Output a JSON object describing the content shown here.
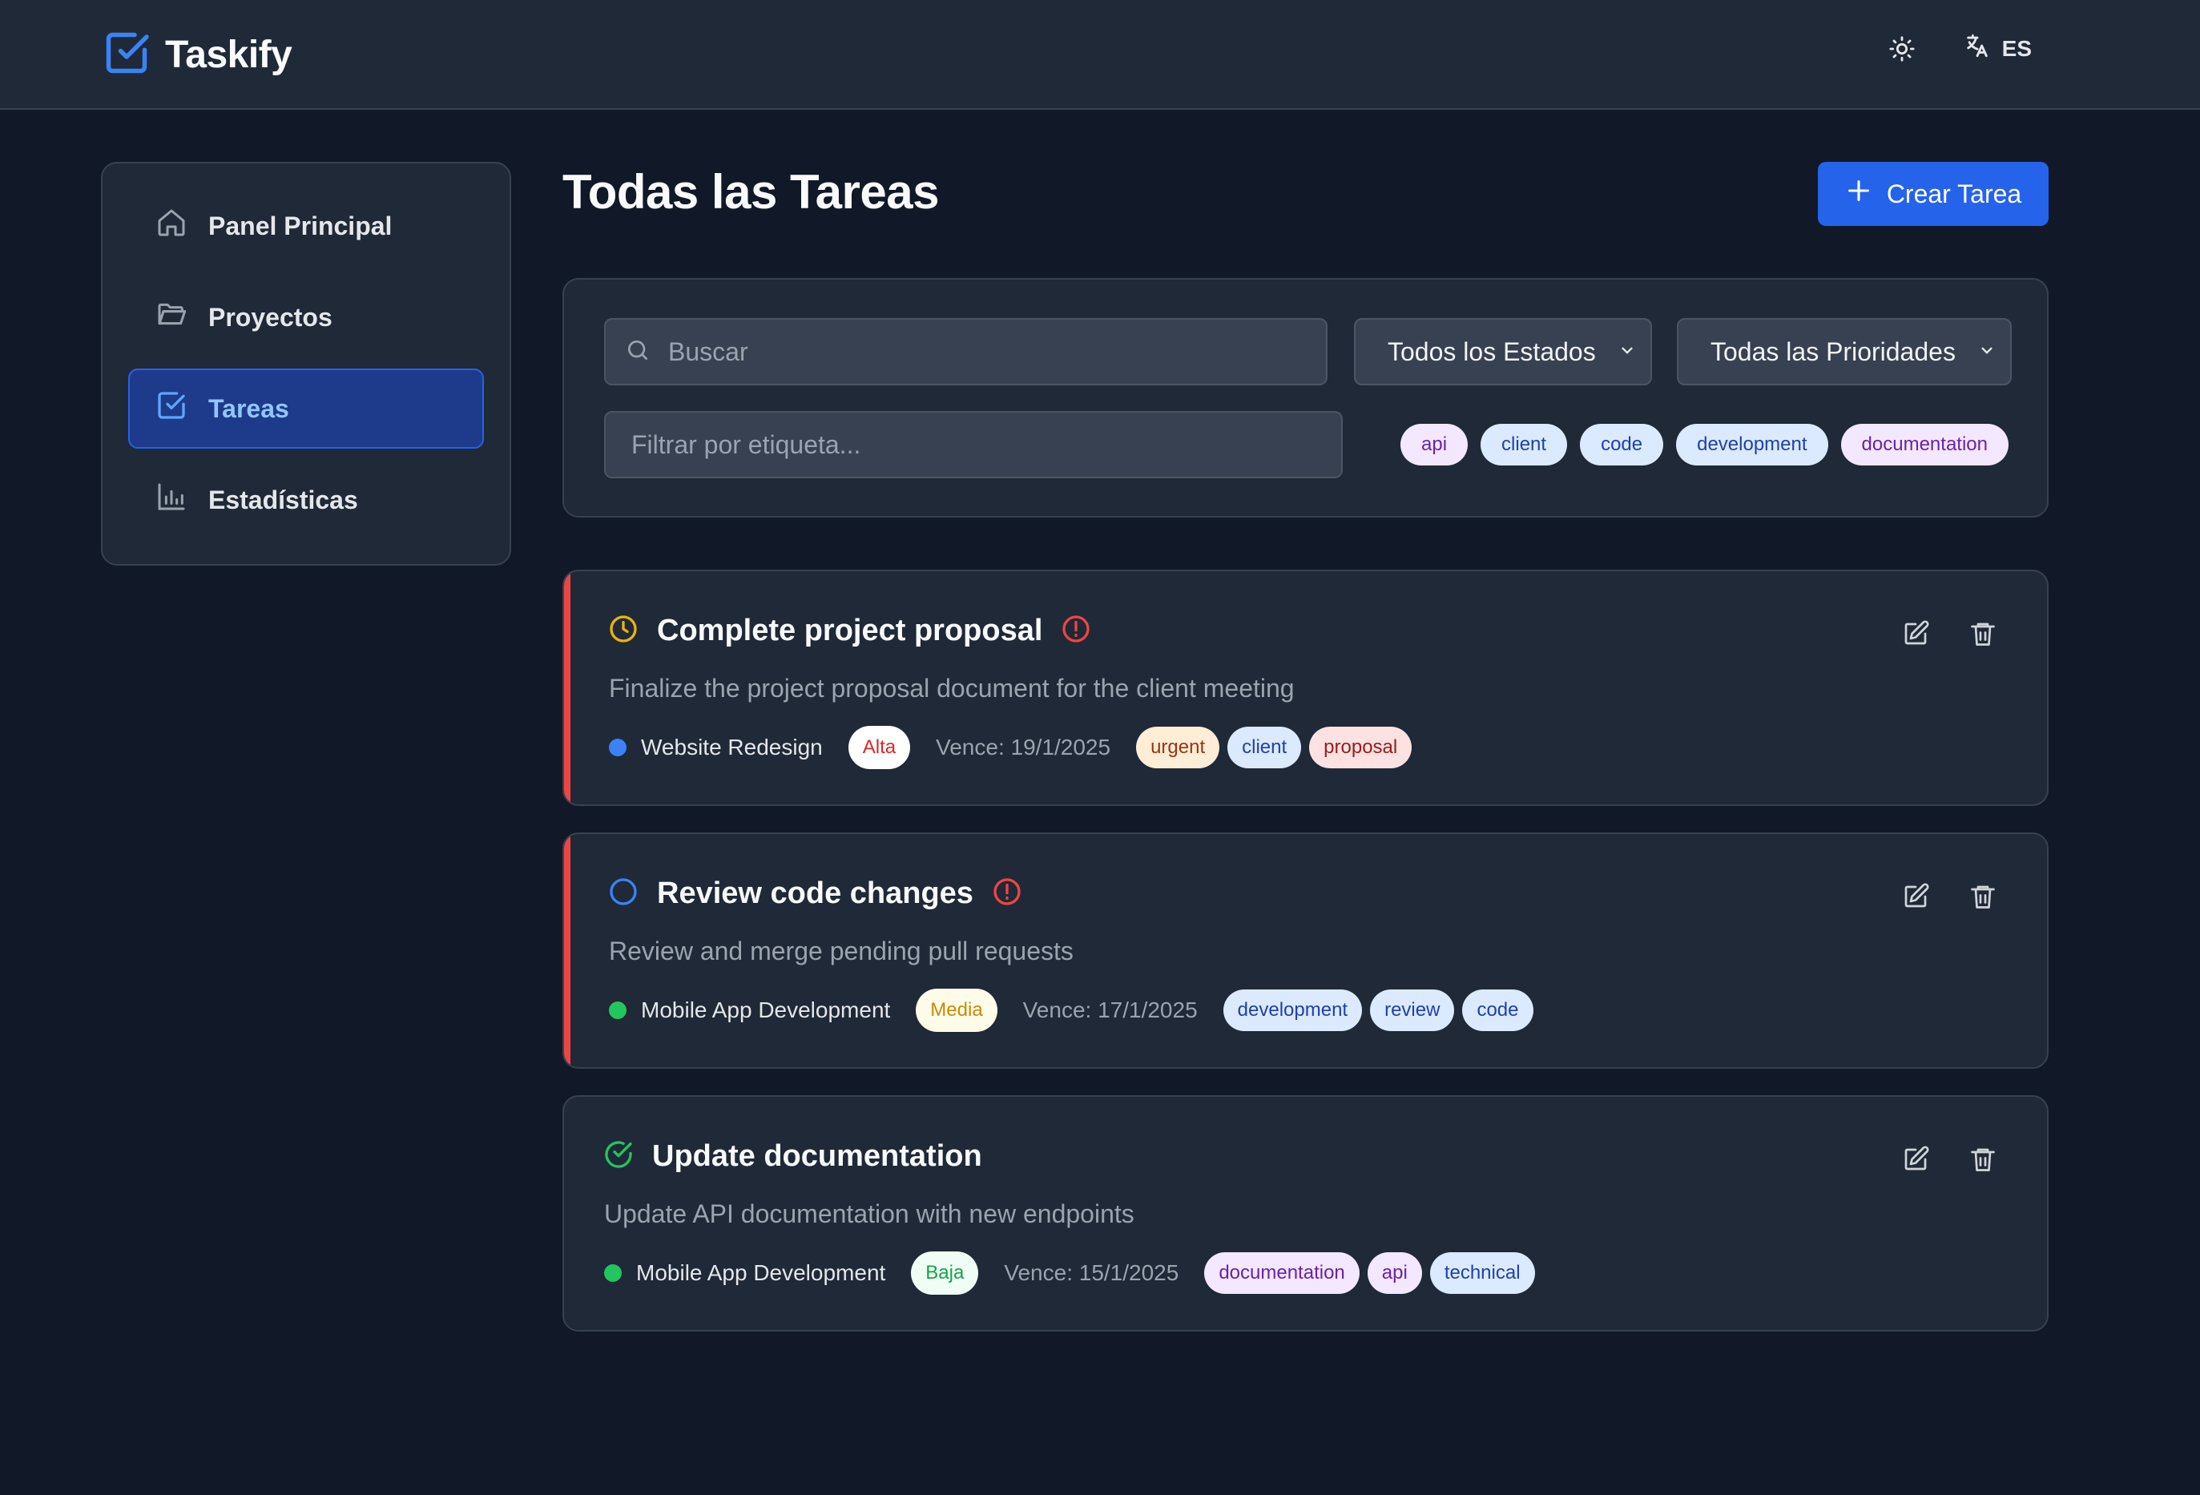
{
  "app": {
    "name": "Taskify",
    "language": "ES"
  },
  "sidebar": {
    "items": [
      {
        "label": "Panel Principal",
        "icon": "home-icon"
      },
      {
        "label": "Proyectos",
        "icon": "folder-icon"
      },
      {
        "label": "Tareas",
        "icon": "task-check-icon",
        "active": true
      },
      {
        "label": "Estadísticas",
        "icon": "bar-chart-icon"
      }
    ]
  },
  "main": {
    "title": "Todas las Tareas",
    "create_label": "Crear Tarea"
  },
  "filters": {
    "search_placeholder": "Buscar",
    "status_value": "Todos los Estados",
    "priority_value": "Todas las Prioridades",
    "tag_placeholder": "Filtrar por etiqueta...",
    "tags": [
      "api",
      "client",
      "code",
      "development",
      "documentation"
    ]
  },
  "tasks": [
    {
      "title": "Complete project proposal",
      "description": "Finalize the project proposal document for the client meeting",
      "status": "in-progress",
      "status_icon": "clock-icon",
      "overdue": true,
      "project": "Website Redesign",
      "project_color": "#3b82f6",
      "priority": "Alta",
      "due": "Vence: 19/1/2025",
      "tags": [
        "urgent",
        "client",
        "proposal"
      ]
    },
    {
      "title": "Review code changes",
      "description": "Review and merge pending pull requests",
      "status": "pending",
      "status_icon": "circle-icon",
      "overdue": true,
      "project": "Mobile App Development",
      "project_color": "#22c55e",
      "priority": "Media",
      "due": "Vence: 17/1/2025",
      "tags": [
        "development",
        "review",
        "code"
      ]
    },
    {
      "title": "Update documentation",
      "description": "Update API documentation with new endpoints",
      "status": "completed",
      "status_icon": "check-circle-icon",
      "overdue": false,
      "project": "Mobile App Development",
      "project_color": "#22c55e",
      "priority": "Baja",
      "due": "Vence: 15/1/2025",
      "tags": [
        "documentation",
        "api",
        "technical"
      ]
    }
  ],
  "colors": {
    "accent": "#2563eb",
    "urgent_border": "#ef4444",
    "tag_purple_bg": "#f3e8ff",
    "tag_purple_fg": "#6b21a8",
    "tag_blue_bg": "#dbeafe",
    "tag_blue_fg": "#1e40af",
    "tag_orange_bg": "#ffedd5",
    "tag_orange_fg": "#9a3412",
    "tag_red_bg": "#fee2e2",
    "tag_red_fg": "#991b1b",
    "prio_high": "#dc2626",
    "prio_medium": "#ca8a04",
    "prio_low": "#16a34a"
  }
}
